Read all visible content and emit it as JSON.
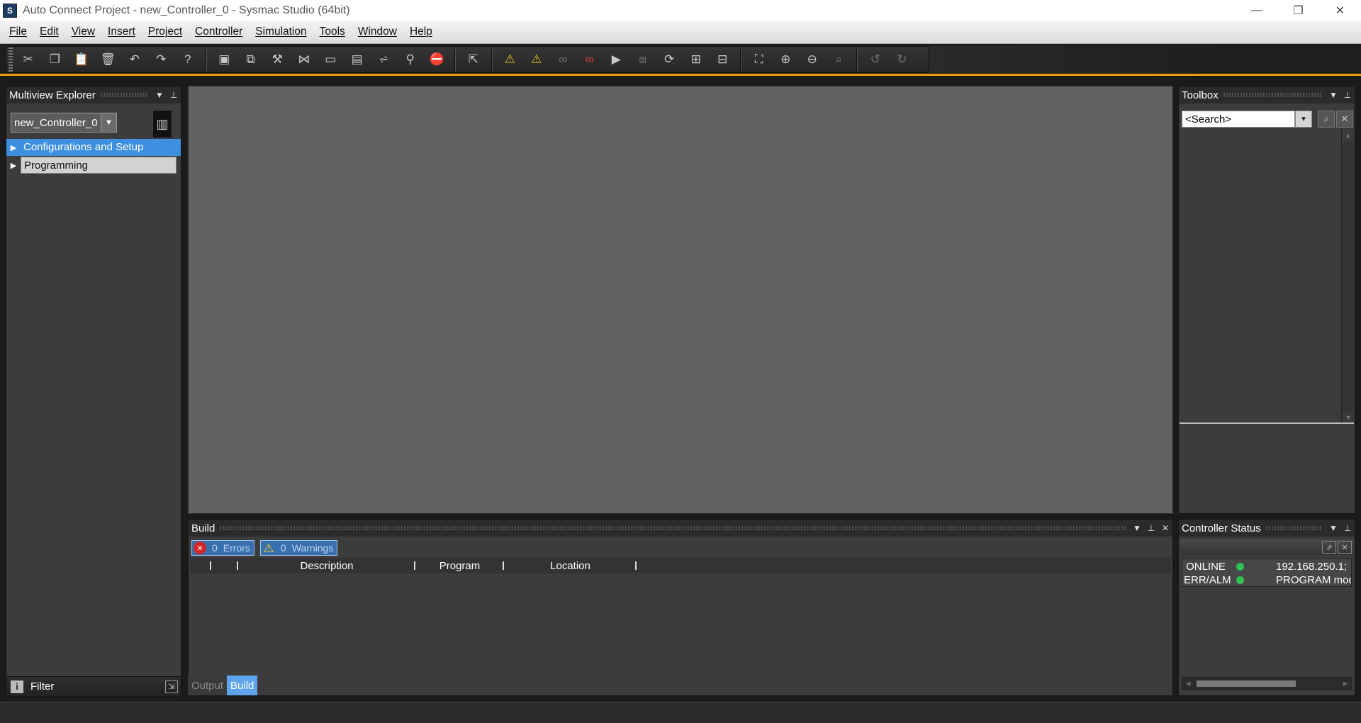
{
  "window": {
    "title": "Auto Connect Project - new_Controller_0 - Sysmac Studio (64bit)",
    "app_icon": "S",
    "minimize": "—",
    "restore": "❐",
    "close": "✕"
  },
  "menu": [
    "File",
    "Edit",
    "View",
    "Insert",
    "Project",
    "Controller",
    "Simulation",
    "Tools",
    "Window",
    "Help"
  ],
  "multiview": {
    "title": "Multiview Explorer",
    "controller": "new_Controller_0",
    "tree": [
      {
        "label": "Configurations and Setup"
      },
      {
        "label": "Programming"
      }
    ],
    "filter_label": "Filter"
  },
  "toolbox": {
    "title": "Toolbox",
    "search_value": "<Search>"
  },
  "build": {
    "title": "Build",
    "errors_count": "0",
    "errors_label": "Errors",
    "warnings_count": "0",
    "warnings_label": "Warnings",
    "columns": [
      "",
      "",
      "Description",
      "Program",
      "Location"
    ]
  },
  "bottom_tabs": [
    "Output",
    "Build"
  ],
  "controller_status": {
    "title": "Controller Status",
    "rows": [
      {
        "key": "ONLINE",
        "value": "192.168.250.1; ",
        "status_color": "#2fc052"
      },
      {
        "key": "ERR/ALM",
        "value": "PROGRAM mod",
        "status_color": "#2fc052"
      }
    ]
  },
  "colors": {
    "accent_orange": "#e3a013",
    "selection_blue": "#3d8fe0",
    "status_green": "#2fc052"
  }
}
